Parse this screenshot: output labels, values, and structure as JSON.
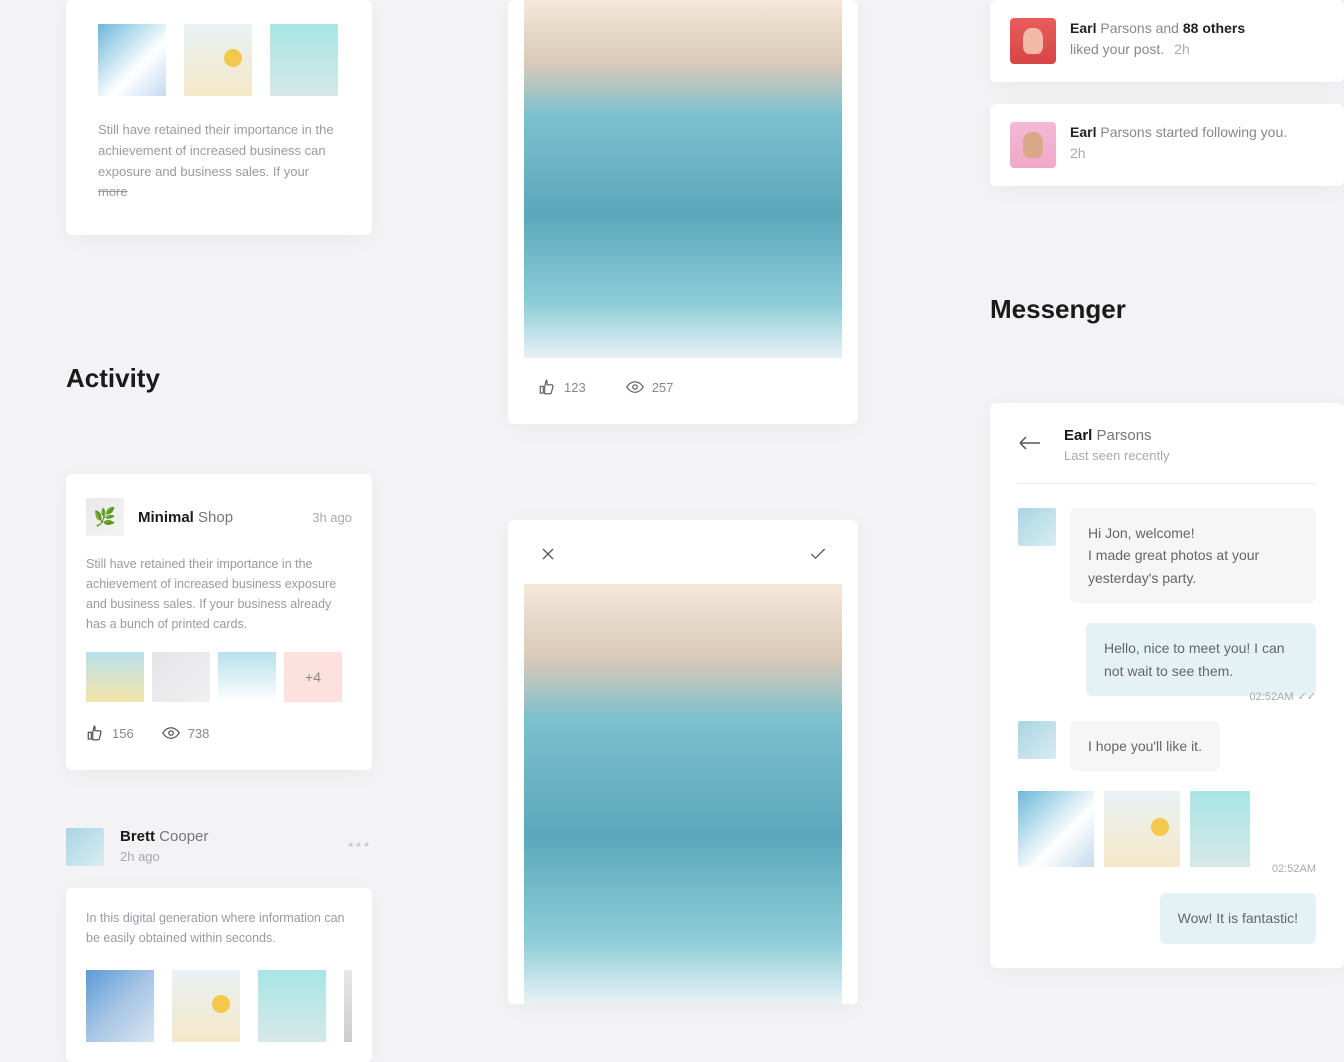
{
  "topCard": {
    "desc": "Still have retained their importance in the achievement of increased business can exposure and business sales. If your ",
    "more": "more"
  },
  "activityTitle": "Activity",
  "activity1": {
    "nameBold": "Minimal",
    "nameRest": " Shop",
    "time": "3h ago",
    "desc": "Still have retained their importance in the achievement of increased business exposure and business sales. If your business already has a bunch of printed cards.",
    "more": "+4",
    "likes": "156",
    "views": "738"
  },
  "activity2": {
    "nameBold": "Brett",
    "nameRest": " Cooper",
    "time": "2h ago",
    "desc": "In this digital generation where information can be easily obtained within seconds."
  },
  "photoCard": {
    "likes": "123",
    "views": "257"
  },
  "notif1": {
    "nameBold": "Earl",
    "nameRest": " Parsons",
    "and": " and ",
    "others": "88 others",
    "action": "liked your post.",
    "time": "2h"
  },
  "notif2": {
    "nameBold": "Earl",
    "nameRest": " Parsons",
    "action": " started following you.",
    "time": "2h"
  },
  "messengerTitle": "Messenger",
  "chat": {
    "nameBold": "Earl",
    "nameRest": " Parsons",
    "status": "Last seen recently",
    "msg1": "Hi Jon, welcome!\nI made great photos at your yesterday's party.",
    "msg2": "Hello, nice to meet you! I can not wait to see them.",
    "time1": "02:52AM",
    "msg3": "I hope you'll like it.",
    "time2": "02:52AM",
    "msg4": "Wow! It is fantastic!"
  }
}
